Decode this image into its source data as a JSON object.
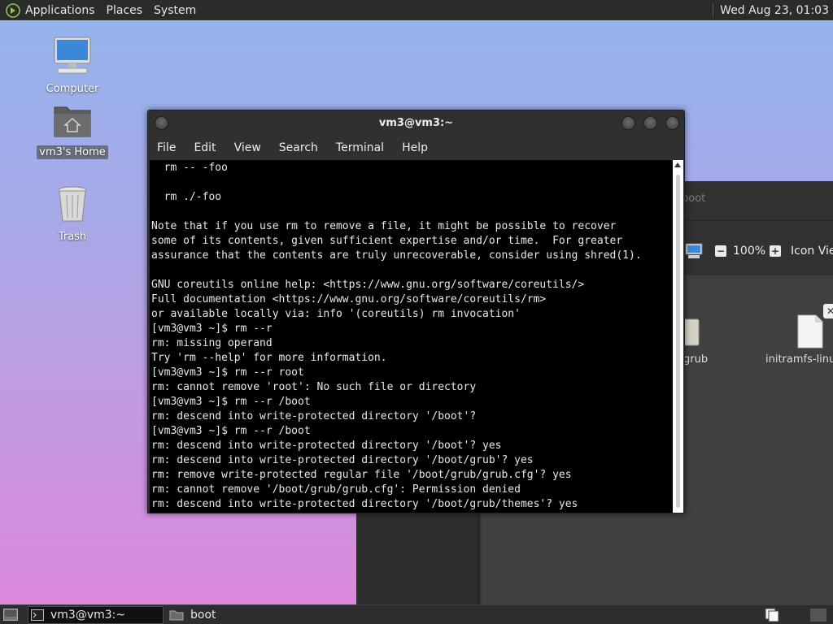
{
  "top_panel": {
    "menus": [
      "Applications",
      "Places",
      "System"
    ],
    "clock": "Wed Aug 23, 01:03"
  },
  "desktop": {
    "icons": [
      {
        "label": "Computer",
        "icon": "computer-icon"
      },
      {
        "label": "vm3's Home",
        "icon": "home-folder-icon"
      },
      {
        "label": "Trash",
        "icon": "trash-icon"
      }
    ]
  },
  "file_manager": {
    "title": "boot",
    "zoom": "100%",
    "view_mode": "Icon View",
    "items": [
      {
        "label": "grub"
      },
      {
        "label": "initramfs-linu"
      }
    ]
  },
  "terminal": {
    "title": "vm3@vm3:~",
    "menus": [
      "File",
      "Edit",
      "View",
      "Search",
      "Terminal",
      "Help"
    ],
    "lines": [
      "  rm -- -foo",
      "",
      "  rm ./-foo",
      "",
      "Note that if you use rm to remove a file, it might be possible to recover",
      "some of its contents, given sufficient expertise and/or time.  For greater",
      "assurance that the contents are truly unrecoverable, consider using shred(1).",
      "",
      "GNU coreutils online help: <https://www.gnu.org/software/coreutils/>",
      "Full documentation <https://www.gnu.org/software/coreutils/rm>",
      "or available locally via: info '(coreutils) rm invocation'",
      "[vm3@vm3 ~]$ rm --r",
      "rm: missing operand",
      "Try 'rm --help' for more information.",
      "[vm3@vm3 ~]$ rm --r root",
      "rm: cannot remove 'root': No such file or directory",
      "[vm3@vm3 ~]$ rm --r /boot",
      "rm: descend into write-protected directory '/boot'?",
      "[vm3@vm3 ~]$ rm --r /boot",
      "rm: descend into write-protected directory '/boot'? yes",
      "rm: descend into write-protected directory '/boot/grub'? yes",
      "rm: remove write-protected regular file '/boot/grub/grub.cfg'? yes",
      "rm: cannot remove '/boot/grub/grub.cfg': Permission denied",
      "rm: descend into write-protected directory '/boot/grub/themes'? yes"
    ]
  },
  "taskbar": {
    "tasks": [
      {
        "label": "vm3@vm3:~",
        "active": true
      },
      {
        "label": "boot",
        "active": false
      }
    ]
  }
}
